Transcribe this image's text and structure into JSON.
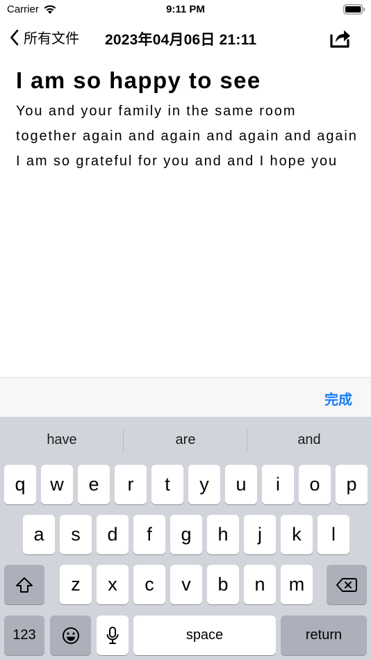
{
  "status_bar": {
    "carrier": "Carrier",
    "time": "9:11 PM"
  },
  "nav": {
    "back_label": "所有文件",
    "title": "2023年04月06日 21:11"
  },
  "note": {
    "title": "I am so happy to see",
    "body": "You and your family in the same room together again and again and again and again I am so grateful for you and and I hope you"
  },
  "accessory": {
    "done_label": "完成"
  },
  "keyboard": {
    "suggestions": [
      "have",
      "are",
      "and"
    ],
    "row1": [
      "q",
      "w",
      "e",
      "r",
      "t",
      "y",
      "u",
      "i",
      "o",
      "p"
    ],
    "row2": [
      "a",
      "s",
      "d",
      "f",
      "g",
      "h",
      "j",
      "k",
      "l"
    ],
    "row3": [
      "z",
      "x",
      "c",
      "v",
      "b",
      "n",
      "m"
    ],
    "numbers_label": "123",
    "space_label": "space",
    "return_label": "return"
  },
  "colors": {
    "accent": "#1a7cf5",
    "keyboard_bg": "#d1d4da",
    "function_key": "#abb0ba"
  }
}
